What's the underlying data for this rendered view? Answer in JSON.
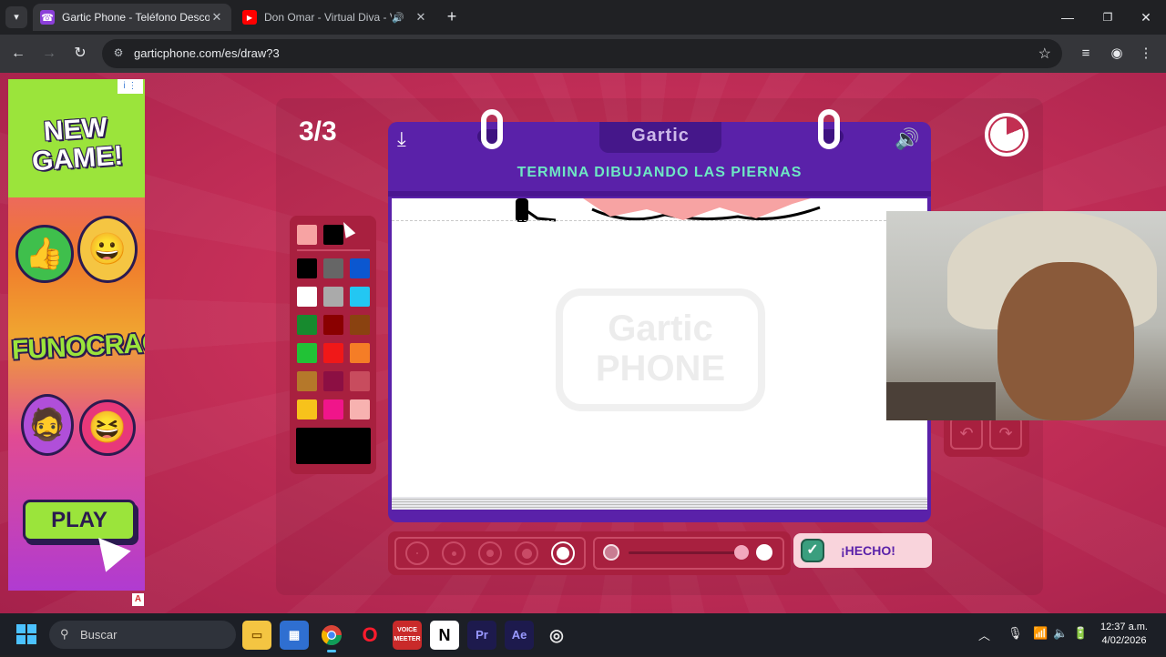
{
  "browser": {
    "tabs": [
      {
        "title": "Gartic Phone - Teléfono Descor",
        "active": true
      },
      {
        "title": "Don Omar - Virtual Diva - V",
        "active": false,
        "playing_audio": true
      }
    ],
    "url": "garticphone.com/es/draw?3"
  },
  "ad": {
    "headline": "NEW GAME!",
    "brand": "FUNOCRACY",
    "cta": "PLAY",
    "choices_label": "i ⋮",
    "badge": "A"
  },
  "game": {
    "round": "3/3",
    "logo": "Gartic",
    "instruction": "TERMINA DIBUJANDO LAS PIERNAS",
    "watermark": "Gartic PHONE",
    "done_label": "¡HECHO!",
    "timer_remaining_fraction": 0.81,
    "palette": {
      "recent": [
        "#f7a3a3",
        "#000000"
      ],
      "colors": [
        "#000000",
        "#666666",
        "#0b57d0",
        "#ffffff",
        "#aaaaaa",
        "#23c7f2",
        "#178a2e",
        "#8a0000",
        "#8a4210",
        "#21c236",
        "#f01818",
        "#f57d26",
        "#b5782a",
        "#8c0f43",
        "#c84c5e",
        "#f7c21b",
        "#f0158a",
        "#f7b2b0"
      ],
      "selected": "#000000"
    },
    "brush_sizes": 5,
    "selected_brush_index": 4,
    "opacity_fraction": 0.95
  },
  "taskbar": {
    "search_placeholder": "Buscar",
    "apps": [
      "file-explorer",
      "store",
      "chrome",
      "opera",
      "voicemeeter",
      "notion",
      "premiere",
      "after-effects",
      "obs"
    ],
    "time": "12:37 a.m.",
    "date": "4/02/2026"
  },
  "colors": {
    "page_bg": "#c52f58",
    "panel_purple": "#5a21a9",
    "instruction_text": "#6ee7c4"
  }
}
